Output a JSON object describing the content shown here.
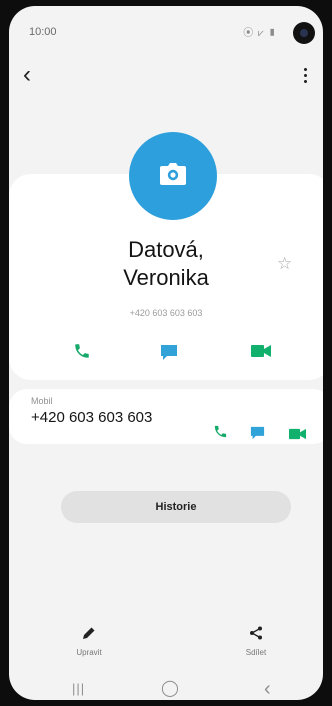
{
  "status_bar": {
    "time": "10:00",
    "icons": "⦿ ⩗ ▮"
  },
  "contact": {
    "name_line1": "Datová,",
    "name_line2": "Veronika",
    "number_small": "+420 603 603 603"
  },
  "phone_entry": {
    "label": "Mobil",
    "number": "+420 603 603 603"
  },
  "history_button": "Historie",
  "bottom_actions": {
    "edit_label": "Upravit",
    "share_label": "Sdílet"
  },
  "colors": {
    "accent_blue": "#2c9fdc",
    "call_green": "#17a96a",
    "message_blue": "#32a3d9",
    "video_green": "#11b06d"
  },
  "icons": [
    "back-icon",
    "more-icon",
    "camera-icon",
    "star-icon",
    "phone-icon",
    "message-icon",
    "video-icon",
    "pencil-icon",
    "share-icon",
    "recent-apps-icon",
    "home-icon",
    "back-nav-icon"
  ]
}
